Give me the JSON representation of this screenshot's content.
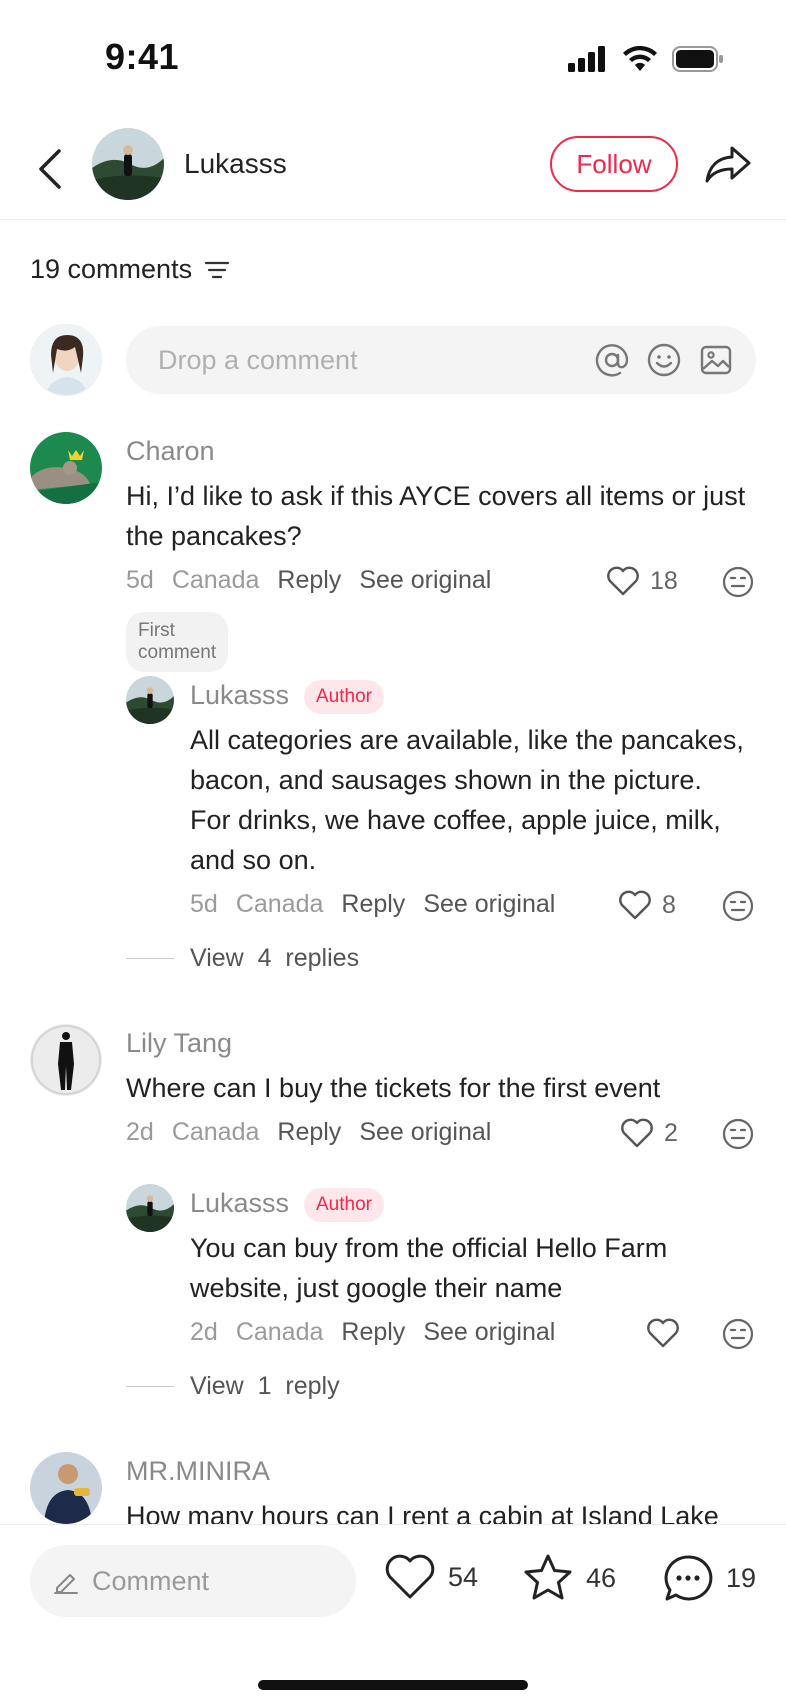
{
  "status": {
    "time": "9:41"
  },
  "header": {
    "username": "Lukasss",
    "follow_label": "Follow"
  },
  "comments_header": {
    "count_label": "19 comments"
  },
  "input": {
    "placeholder": "Drop a comment"
  },
  "comments": [
    {
      "name": "Charon",
      "text": "Hi, I’d like to ask if this AYCE covers all items or just the pancakes?",
      "age": "5d",
      "location": "Canada",
      "reply_label": "Reply",
      "see_original_label": "See original",
      "likes": "18",
      "badge": "First comment",
      "replies": [
        {
          "name": "Lukasss",
          "badge": "Author",
          "text": "All categories are available, like the pancakes, bacon, and sausages shown in the picture. For drinks, we have coffee, apple juice, milk, and so on.",
          "age": "5d",
          "location": "Canada",
          "reply_label": "Reply",
          "see_original_label": "See original",
          "likes": "8"
        }
      ],
      "view_replies": "View  4  replies"
    },
    {
      "name": "Lily Tang",
      "text": "Where can I buy the tickets for the first event",
      "age": "2d",
      "location": "Canada",
      "reply_label": "Reply",
      "see_original_label": "See original",
      "likes": "2",
      "replies": [
        {
          "name": "Lukasss",
          "badge": "Author",
          "text": "You can buy from the official Hello Farm website, just google their name",
          "age": "2d",
          "location": "Canada",
          "reply_label": "Reply",
          "see_original_label": "See original",
          "likes": ""
        }
      ],
      "view_replies": "View  1  reply"
    },
    {
      "name": "MR.MINIRA",
      "text": "How many hours can I rent a cabin at Island Lake"
    }
  ],
  "bottom_bar": {
    "comment_placeholder": "Comment",
    "likes": "54",
    "favorites": "46",
    "comments": "19"
  },
  "colors": {
    "accent": "#f0284a",
    "author_badge_bg": "#fde7ea"
  }
}
